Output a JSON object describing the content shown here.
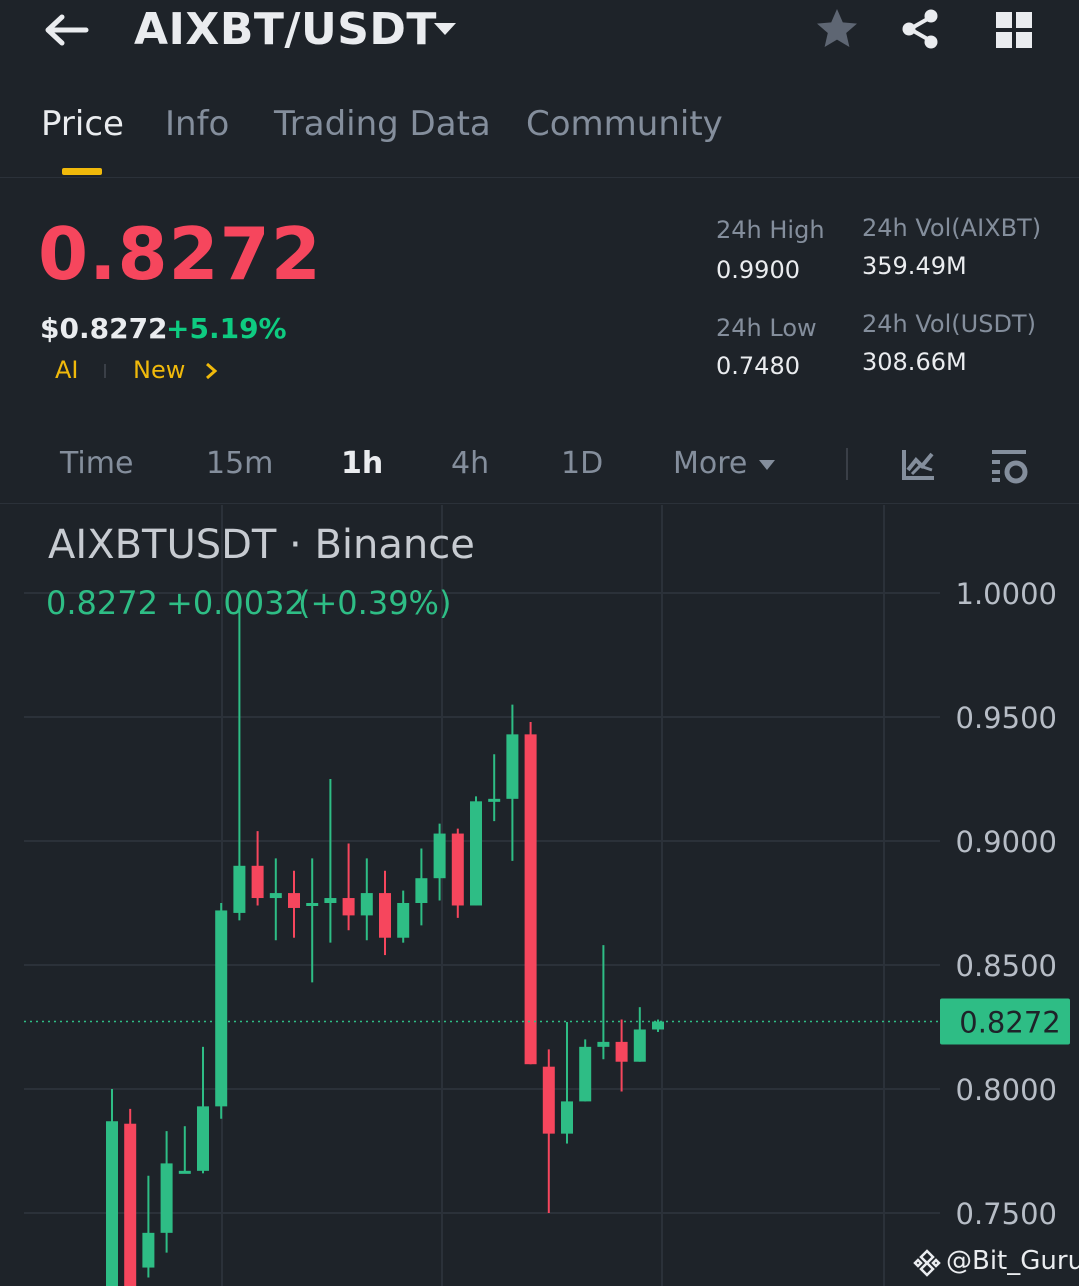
{
  "header": {
    "pair": "AIXBT/USDT"
  },
  "tabs": [
    {
      "label": "Price",
      "active": true
    },
    {
      "label": "Info",
      "active": false
    },
    {
      "label": "Trading Data",
      "active": false
    },
    {
      "label": "Community",
      "active": false
    }
  ],
  "price": {
    "last": "0.8272",
    "usd": "$0.8272",
    "change_pct": "+5.19%"
  },
  "tags": {
    "tag1": "AI",
    "tag2": "New"
  },
  "stats": {
    "high_label": "24h High",
    "high_value": "0.9900",
    "low_label": "24h Low",
    "low_value": "0.7480",
    "vol_base_label": "24h Vol(AIXBT)",
    "vol_base_value": "359.49M",
    "vol_quote_label": "24h Vol(USDT)",
    "vol_quote_value": "308.66M"
  },
  "intervals": [
    {
      "label": "Time",
      "active": false
    },
    {
      "label": "15m",
      "active": false
    },
    {
      "label": "1h",
      "active": true
    },
    {
      "label": "4h",
      "active": false
    },
    {
      "label": "1D",
      "active": false
    },
    {
      "label": "More",
      "active": false
    }
  ],
  "chart_header": {
    "symbol": "AIXBTUSDT · Binance",
    "last": "0.8272",
    "change": "+0.0032",
    "change_pct": "(+0.39%)"
  },
  "watermark": "@Bit_Guru",
  "colors": {
    "up": "#2ebd85",
    "down": "#f6465d",
    "accent": "#f0b90b",
    "background": "#1e2329"
  },
  "chart_data": {
    "type": "candlestick",
    "y_ticks": [
      "1.0000",
      "0.9500",
      "0.9000",
      "0.8500",
      "0.8000",
      "0.7500"
    ],
    "ylim": [
      0.72,
      1.0
    ],
    "last_price_label": "0.8272",
    "last_price": 0.8272,
    "candles": [
      {
        "o": 0.72,
        "h": 0.8,
        "l": 0.72,
        "c": 0.787
      },
      {
        "o": 0.786,
        "h": 0.792,
        "l": 0.72,
        "c": 0.72
      },
      {
        "o": 0.728,
        "h": 0.765,
        "l": 0.724,
        "c": 0.742
      },
      {
        "o": 0.742,
        "h": 0.783,
        "l": 0.734,
        "c": 0.77
      },
      {
        "o": 0.766,
        "h": 0.785,
        "l": 0.766,
        "c": 0.767
      },
      {
        "o": 0.767,
        "h": 0.817,
        "l": 0.766,
        "c": 0.793
      },
      {
        "o": 0.793,
        "h": 0.875,
        "l": 0.788,
        "c": 0.872
      },
      {
        "o": 0.871,
        "h": 0.997,
        "l": 0.868,
        "c": 0.89
      },
      {
        "o": 0.89,
        "h": 0.904,
        "l": 0.874,
        "c": 0.877
      },
      {
        "o": 0.877,
        "h": 0.893,
        "l": 0.86,
        "c": 0.879
      },
      {
        "o": 0.879,
        "h": 0.888,
        "l": 0.861,
        "c": 0.873
      },
      {
        "o": 0.875,
        "h": 0.893,
        "l": 0.843,
        "c": 0.875
      },
      {
        "o": 0.875,
        "h": 0.925,
        "l": 0.859,
        "c": 0.877
      },
      {
        "o": 0.877,
        "h": 0.899,
        "l": 0.864,
        "c": 0.87
      },
      {
        "o": 0.87,
        "h": 0.893,
        "l": 0.86,
        "c": 0.879
      },
      {
        "o": 0.879,
        "h": 0.888,
        "l": 0.854,
        "c": 0.861
      },
      {
        "o": 0.861,
        "h": 0.88,
        "l": 0.859,
        "c": 0.875
      },
      {
        "o": 0.875,
        "h": 0.897,
        "l": 0.866,
        "c": 0.885
      },
      {
        "o": 0.885,
        "h": 0.907,
        "l": 0.876,
        "c": 0.903
      },
      {
        "o": 0.903,
        "h": 0.905,
        "l": 0.869,
        "c": 0.874
      },
      {
        "o": 0.874,
        "h": 0.918,
        "l": 0.874,
        "c": 0.916
      },
      {
        "o": 0.916,
        "h": 0.935,
        "l": 0.908,
        "c": 0.917
      },
      {
        "o": 0.917,
        "h": 0.955,
        "l": 0.892,
        "c": 0.943
      },
      {
        "o": 0.943,
        "h": 0.948,
        "l": 0.81,
        "c": 0.81
      },
      {
        "o": 0.809,
        "h": 0.816,
        "l": 0.75,
        "c": 0.782
      },
      {
        "o": 0.782,
        "h": 0.827,
        "l": 0.778,
        "c": 0.795
      },
      {
        "o": 0.795,
        "h": 0.82,
        "l": 0.795,
        "c": 0.817
      },
      {
        "o": 0.817,
        "h": 0.858,
        "l": 0.812,
        "c": 0.819
      },
      {
        "o": 0.819,
        "h": 0.828,
        "l": 0.799,
        "c": 0.811
      },
      {
        "o": 0.811,
        "h": 0.833,
        "l": 0.811,
        "c": 0.824
      },
      {
        "o": 0.824,
        "h": 0.828,
        "l": 0.823,
        "c": 0.8272
      }
    ]
  }
}
